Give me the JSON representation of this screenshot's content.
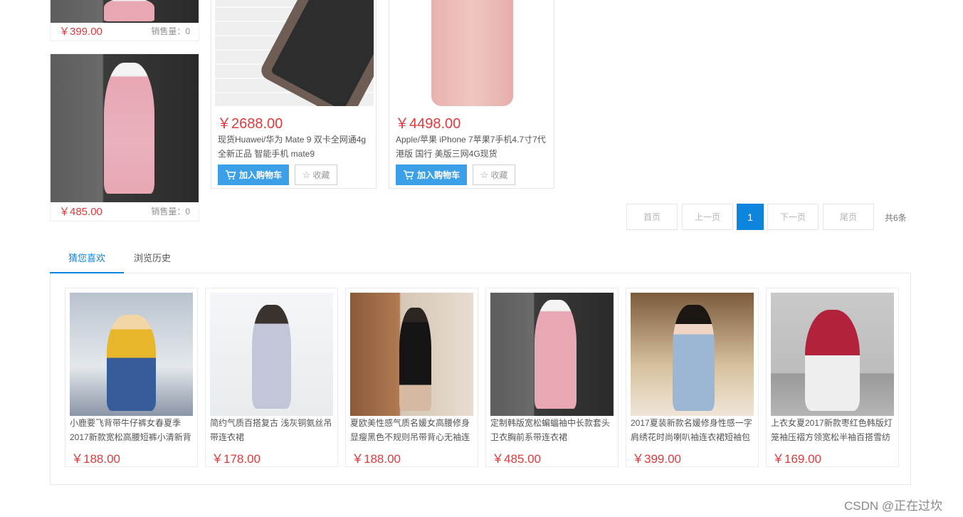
{
  "left_column": [
    {
      "price": "￥399.00",
      "sales": "销售量：0",
      "image": "dress-photo"
    },
    {
      "price": "￥485.00",
      "sales": "销售量：0",
      "image": "pink-hoodie-dress-photo"
    }
  ],
  "products": [
    {
      "price": "￥2688.00",
      "title": "现货Huawei/华为 Mate 9 双卡全网通4g 全新正品 智能手机 mate9",
      "cart_label": "加入购物车",
      "fav_label": "收藏",
      "image": "huawei-phone-photo"
    },
    {
      "price": "￥4498.00",
      "title": "Apple/苹果 iPhone 7苹果7手机4.7寸7代港版 国行 美版三网4G现货",
      "cart_label": "加入购物车",
      "fav_label": "收藏",
      "image": "pink-iphone-photo"
    }
  ],
  "pagination": {
    "first": "首页",
    "prev": "上一页",
    "current": "1",
    "next": "下一页",
    "last": "尾页",
    "total": "共6条"
  },
  "tabs": [
    {
      "label": "猜您喜欢",
      "active": true
    },
    {
      "label": "浏览历史",
      "active": false
    }
  ],
  "recommendations": [
    {
      "title": "小鹿要飞背带牛仔裤女春夏季2017新款宽松高腰短裤小清新背",
      "price": "￥188.00"
    },
    {
      "title": "简约气质百搭复古 浅灰铜氨丝吊带连衣裙",
      "price": "￥178.00"
    },
    {
      "title": "夏欧美性感气质名媛女高腰修身显瘦黑色不规则吊带背心无袖连",
      "price": "￥188.00"
    },
    {
      "title": "定制韩版宽松蝙蝠袖中长款套头卫衣胸前系带连衣裙",
      "price": "￥485.00"
    },
    {
      "title": "2017夏装新款名媛修身性感一字肩绣花时尚喇叭袖连衣裙短袖包",
      "price": "￥399.00"
    },
    {
      "title": "上衣女夏2017新款枣红色韩版灯笼袖压褶方领宽松半袖百搭雪纺",
      "price": "￥169.00"
    }
  ],
  "watermark": "CSDN @正在过坎",
  "colors": {
    "price": "#e4393c",
    "accent": "#0d85dc",
    "cart_button": "#3ba0e8"
  }
}
